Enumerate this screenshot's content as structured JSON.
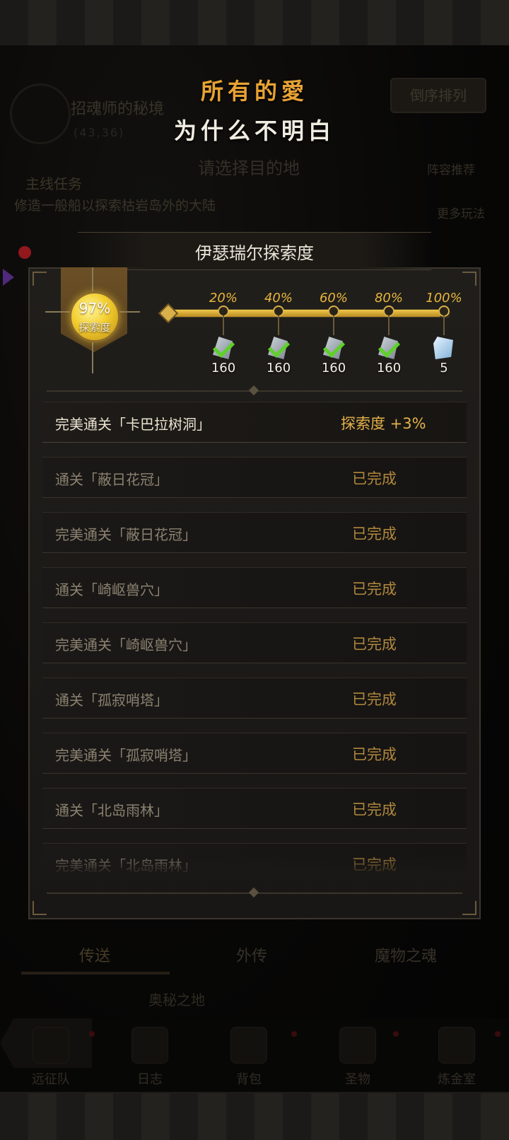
{
  "background": {
    "map_title": "招魂师的秘境",
    "coords": "(43,36)",
    "sort_button": "倒序排列",
    "select_destination": "请选择目的地",
    "main_quest_label": "主线任务",
    "main_quest_desc": "修造一般船以探索枯岩岛外的大陆",
    "lineup_recommend": "阵容推荐",
    "more_gameplay": "更多玩法",
    "tabs": [
      "传送",
      "外传",
      "魔物之魂"
    ],
    "subtitle": "奥秘之地",
    "nav": [
      "远征队",
      "日志",
      "背包",
      "圣物",
      "炼金室"
    ]
  },
  "caption": {
    "line1": "所有的愛",
    "line2": "为什么不明白"
  },
  "panel": {
    "title": "伊瑟瑞尔探索度",
    "progress_percent": "97%",
    "progress_label": "探索度",
    "progress_value": 0.97,
    "milestones": [
      {
        "label": "20%",
        "reward_count": "160",
        "claimed": true
      },
      {
        "label": "40%",
        "reward_count": "160",
        "claimed": true
      },
      {
        "label": "60%",
        "reward_count": "160",
        "claimed": true
      },
      {
        "label": "80%",
        "reward_count": "160",
        "claimed": true
      },
      {
        "label": "100%",
        "reward_count": "5",
        "claimed": false
      }
    ],
    "tasks": [
      {
        "name": "完美通关「卡巴拉树洞」",
        "status": "探索度  +3%",
        "current": true
      },
      {
        "name": "通关「蔽日花冠」",
        "status": "已完成",
        "current": false
      },
      {
        "name": "完美通关「蔽日花冠」",
        "status": "已完成",
        "current": false
      },
      {
        "name": "通关「崎岖兽穴」",
        "status": "已完成",
        "current": false
      },
      {
        "name": "完美通关「崎岖兽穴」",
        "status": "已完成",
        "current": false
      },
      {
        "name": "通关「孤寂哨塔」",
        "status": "已完成",
        "current": false
      },
      {
        "name": "完美通关「孤寂哨塔」",
        "status": "已完成",
        "current": false
      },
      {
        "name": "通关「北岛雨林」",
        "status": "已完成",
        "current": false
      },
      {
        "name": "完美通关「北岛雨林」",
        "status": "已完成",
        "current": false
      }
    ]
  },
  "colors": {
    "accent_gold": "#e8b53c",
    "done_text": "#b0883e",
    "check_green": "#5fd02b",
    "caption_orange": "#e8a233"
  }
}
